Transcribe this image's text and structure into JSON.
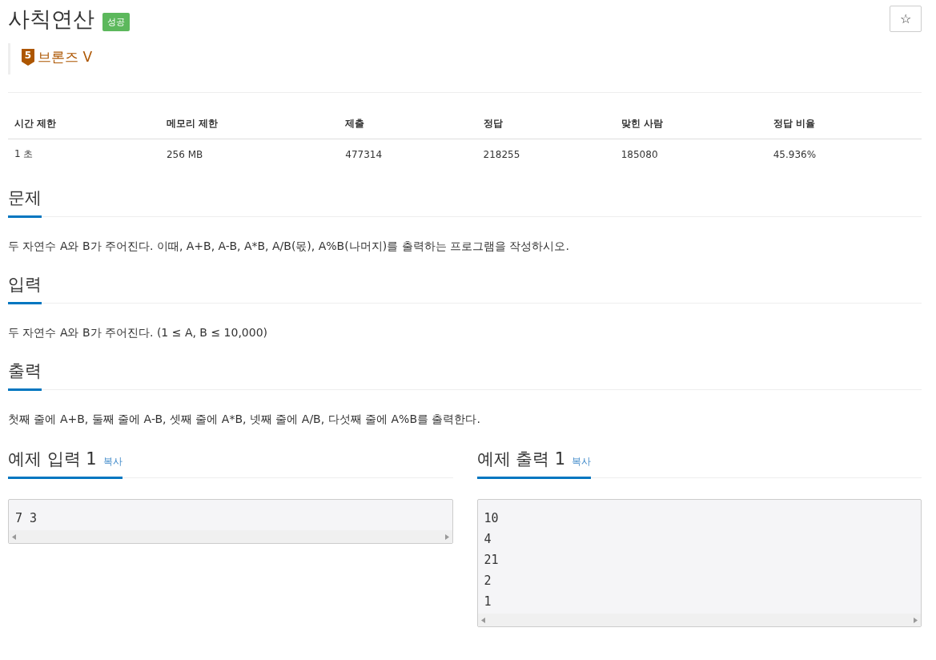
{
  "title": "사칙연산",
  "result_badge": "성공",
  "star_button": "☆",
  "tier": {
    "number": "5",
    "label": "브론즈 V"
  },
  "table": {
    "columns": [
      "시간 제한",
      "메모리 제한",
      "제출",
      "정답",
      "맞힌 사람",
      "정답 비율"
    ],
    "rows": [
      [
        "1 초",
        "256 MB",
        "477314",
        "218255",
        "185080",
        "45.936%"
      ]
    ]
  },
  "sections": [
    {
      "heading": "문제",
      "text": "두 자연수 A와 B가 주어진다. 이때, A+B, A-B, A*B, A/B(몫), A%B(나머지)를 출력하는 프로그램을 작성하시오."
    },
    {
      "heading": "입력",
      "text": "두 자연수 A와 B가 주어진다. (1 ≤ A, B ≤ 10,000)"
    },
    {
      "heading": "출력",
      "text": "첫째 줄에 A+B, 둘째 줄에 A-B, 셋째 줄에 A*B, 넷째 줄에 A/B, 다섯째 줄에 A%B를 출력한다."
    }
  ],
  "samples": [
    {
      "heading": "예제 입력 1",
      "copy": "복사",
      "lines": [
        "7 3"
      ]
    },
    {
      "heading": "예제 출력 1",
      "copy": "복사",
      "lines": [
        "10",
        "4",
        "21",
        "2",
        "1"
      ]
    }
  ]
}
